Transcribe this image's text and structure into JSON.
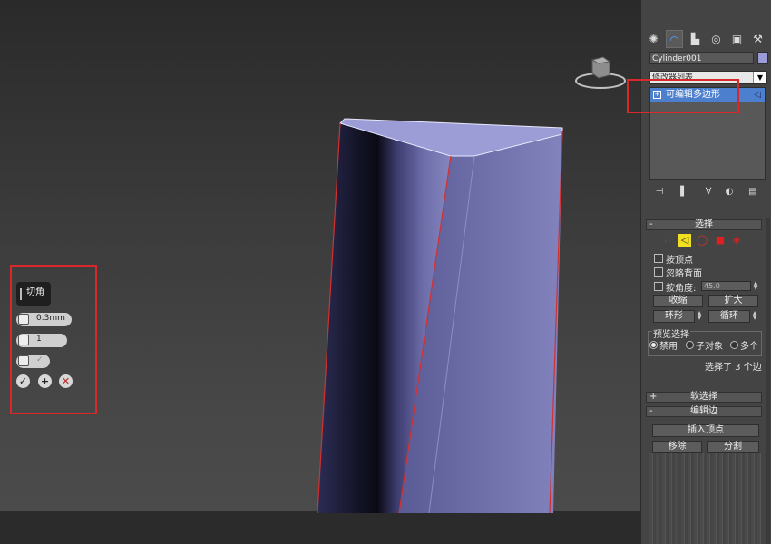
{
  "caddy": {
    "title": "切角",
    "fields": [
      {
        "icon": "chamfer-amount-icon",
        "value": "0.3mm"
      },
      {
        "icon": "segments-icon",
        "value": "1"
      },
      {
        "icon": "open-chamfer-icon",
        "value": ""
      }
    ],
    "buttons": [
      "✓",
      "+",
      "✕"
    ]
  },
  "panel": {
    "tabs": [
      {
        "icon": "create-icon",
        "glyph": "✺"
      },
      {
        "icon": "modify-icon",
        "glyph": "◠"
      },
      {
        "icon": "hierarchy-icon",
        "glyph": "▙"
      },
      {
        "icon": "motion-icon",
        "glyph": "◎"
      },
      {
        "icon": "display-icon",
        "glyph": "▣"
      },
      {
        "icon": "utilities-icon",
        "glyph": "⚒"
      }
    ],
    "object_name": "Cylinder001",
    "object_color": "#9a9bd8",
    "modifier_list": "修改器列表",
    "stack_item": "可编辑多边形",
    "stack_buttons": [
      "⊣",
      "▌",
      "∀",
      "◐",
      "▤"
    ],
    "selection": {
      "title": "选择",
      "sub_icons": [
        "∴",
        "◁",
        "◯",
        "■",
        "◈"
      ],
      "by_vertex": "按顶点",
      "ignore_backfacing": "忽略背面",
      "by_angle": "按角度:",
      "angle_value": "45.0",
      "shrink": "收缩",
      "grow": "扩大",
      "ring": "环形",
      "loop": "循环",
      "preview_label": "预览选择",
      "preview_options": [
        "禁用",
        "子对象",
        "多个"
      ],
      "status": "选择了 3 个边"
    },
    "soft_selection": "软选择",
    "edit_edges": {
      "title": "编辑边",
      "insert_vertex": "插入顶点",
      "remove": "移除",
      "split": "分割"
    }
  },
  "colors": {
    "highlight": "#d8282c",
    "active_modifier": "#4d7fcf",
    "object": "#8080c8"
  }
}
